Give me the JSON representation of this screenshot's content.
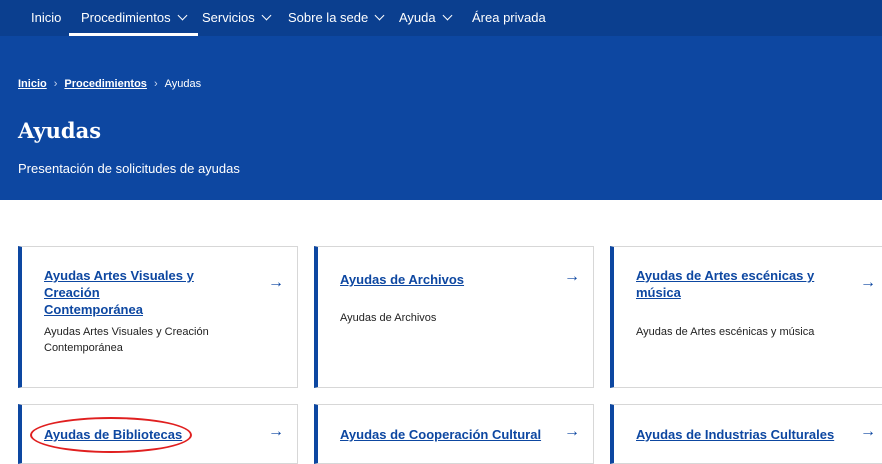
{
  "nav": {
    "items": [
      {
        "label": "Inicio"
      },
      {
        "label": "Procedimientos"
      },
      {
        "label": "Servicios"
      },
      {
        "label": "Sobre la sede"
      },
      {
        "label": "Ayuda"
      },
      {
        "label": "Área privada"
      }
    ]
  },
  "breadcrumb": {
    "items": [
      "Inicio",
      "Procedimientos",
      "Ayudas"
    ],
    "separator": "›"
  },
  "page": {
    "title": "Ayudas",
    "subtitle": "Presentación de solicitudes de ayudas"
  },
  "cards": [
    {
      "title_l1": "Ayudas Artes Visuales y Creación",
      "title_l2": "Contemporánea",
      "desc_l1": "Ayudas Artes Visuales y Creación",
      "desc_l2": "Contemporánea",
      "arrow": "→"
    },
    {
      "title_l1": "Ayudas de Archivos",
      "title_l2": "",
      "desc_l1": "Ayudas de Archivos",
      "desc_l2": "",
      "arrow": "→"
    },
    {
      "title_l1": "Ayudas de Artes escénicas y",
      "title_l2": "música",
      "desc_l1": "Ayudas de Artes escénicas y música",
      "desc_l2": "",
      "arrow": "→"
    },
    {
      "title_l1": "Ayudas de Bibliotecas",
      "title_l2": "",
      "desc_l1": "",
      "desc_l2": "",
      "arrow": "→"
    },
    {
      "title_l1": "Ayudas de Cooperación Cultural",
      "title_l2": "",
      "desc_l1": "",
      "desc_l2": "",
      "arrow": "→"
    },
    {
      "title_l1": "Ayudas de Industrias Culturales",
      "title_l2": "",
      "desc_l1": "",
      "desc_l2": "",
      "arrow": "→"
    }
  ],
  "colors": {
    "nav_bg": "#0b3f8f",
    "hero_bg": "#0d47a1",
    "card_accent": "#0d47a1",
    "highlight": "#e01f1f"
  }
}
